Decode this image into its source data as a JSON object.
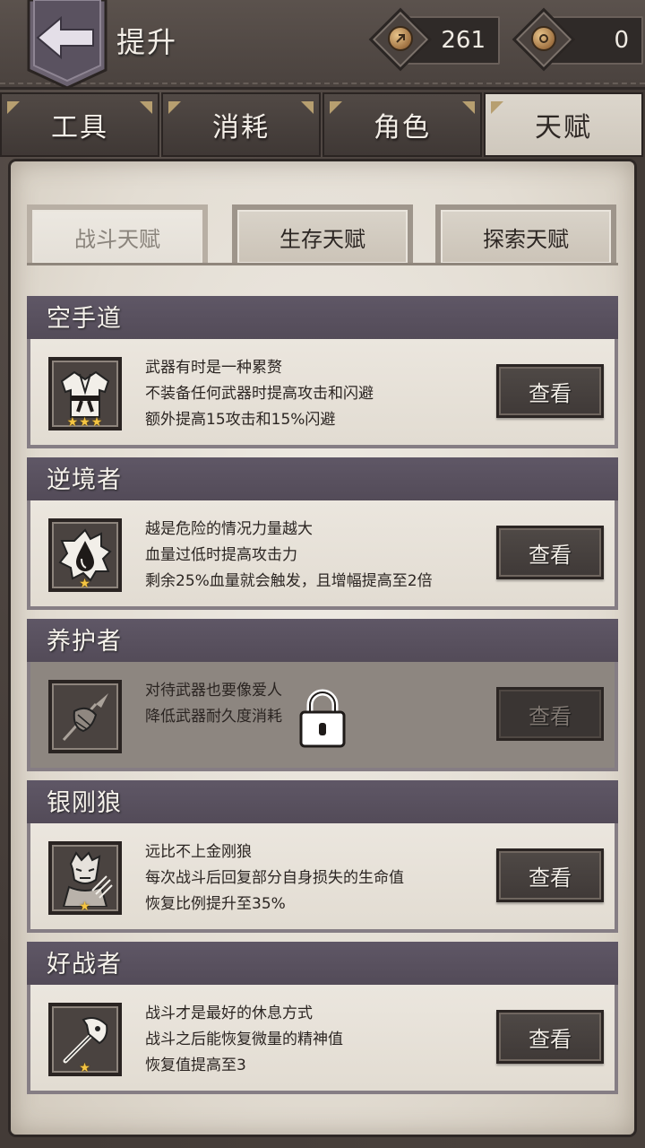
{
  "header": {
    "title": "提升",
    "currency_a": {
      "value": "261",
      "icon": "coin-icon"
    },
    "currency_b": {
      "value": "0",
      "icon": "coin-icon"
    }
  },
  "categories": [
    {
      "label": "工具",
      "active": false
    },
    {
      "label": "消耗",
      "active": false
    },
    {
      "label": "角色",
      "active": false
    },
    {
      "label": "天赋",
      "active": true
    }
  ],
  "subtabs": [
    {
      "label": "战斗天赋",
      "active": true
    },
    {
      "label": "生存天赋",
      "active": false
    },
    {
      "label": "探索天赋",
      "active": false
    }
  ],
  "view_label": "查看",
  "talents": [
    {
      "name": "空手道",
      "icon": "karate-gi-icon",
      "stars": 3,
      "locked": false,
      "lines": [
        "武器有时是一种累赘",
        "不装备任何武器时提高攻击和闪避",
        "额外提高15攻击和15%闪避"
      ]
    },
    {
      "name": "逆境者",
      "icon": "blood-drop-icon",
      "stars": 1,
      "locked": false,
      "lines": [
        "越是危险的情况力量越大",
        "血量过低时提高攻击力",
        "剩余25%血量就会触发，且增幅提高至2倍"
      ]
    },
    {
      "name": "养护者",
      "icon": "wrapped-spear-icon",
      "stars": 0,
      "locked": true,
      "lines": [
        "对待武器也要像爱人",
        "降低武器耐久度消耗"
      ]
    },
    {
      "name": "银刚狼",
      "icon": "wolverine-icon",
      "stars": 1,
      "locked": false,
      "lines": [
        "远比不上金刚狼",
        "每次战斗后回复部分自身损失的生命值",
        "恢复比例提升至35%"
      ]
    },
    {
      "name": "好战者",
      "icon": "axe-icon",
      "stars": 1,
      "locked": false,
      "lines": [
        "战斗才是最好的休息方式",
        "战斗之后能恢复微量的精神值",
        "恢复值提高至3"
      ]
    }
  ]
}
